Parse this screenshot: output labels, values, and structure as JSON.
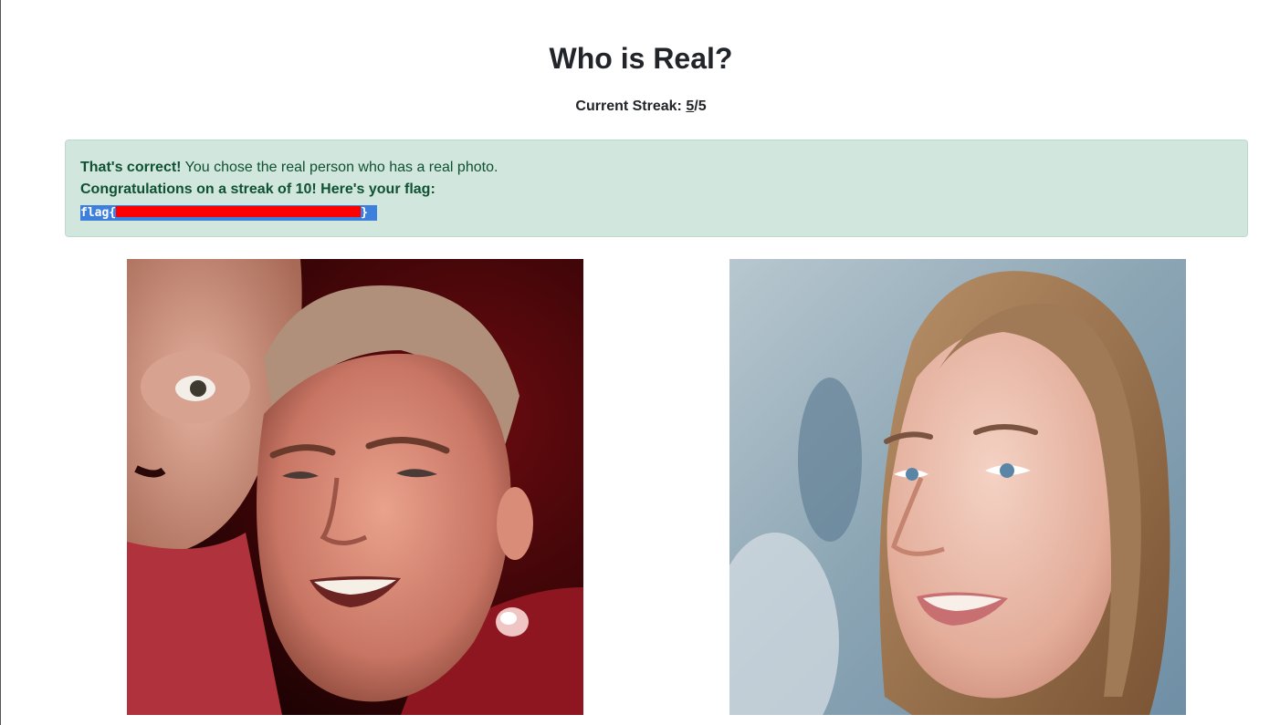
{
  "page": {
    "title": "Who is Real?"
  },
  "streak": {
    "label": "Current Streak: ",
    "current": "5",
    "separator": "/",
    "total": "5"
  },
  "alert": {
    "correct_strong": "That's correct!",
    "correct_text": " You chose the real person who has a real photo.",
    "congrats": "Congratulations on a streak of 10! Here's your flag:",
    "flag_prefix": "flag{",
    "flag_suffix": "}"
  },
  "photos": [
    {
      "name": "left-portrait",
      "subject": "smiling man with another person"
    },
    {
      "name": "right-portrait",
      "subject": "smiling young woman"
    }
  ],
  "colors": {
    "alert_bg": "#d1e7dd",
    "alert_text": "#0f5132",
    "flag_highlight": "#3d7fdc",
    "redaction": "#ff0000"
  }
}
